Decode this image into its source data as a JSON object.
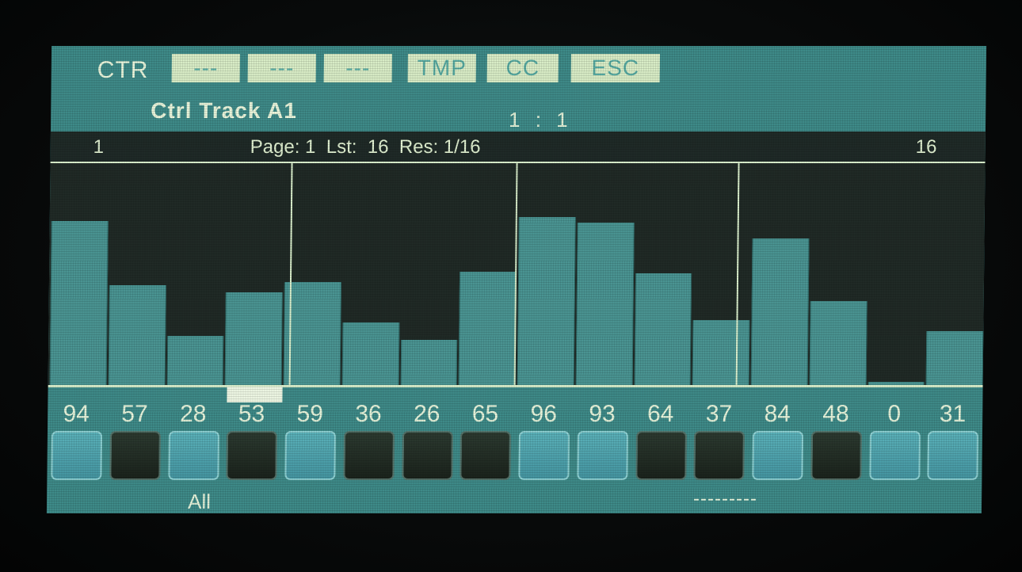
{
  "header": {
    "mode_label": "CTR",
    "softkeys": [
      "---",
      "---",
      "---",
      "TMP",
      "CC",
      "ESC"
    ],
    "track_name": "Ctrl Track A1",
    "position": "1 : 1"
  },
  "infobar": {
    "left_step": "1",
    "page_info": "Page: 1  Lst:  16  Res: 1/16",
    "right_step": "16"
  },
  "steps": [
    {
      "value": "94",
      "active": true
    },
    {
      "value": "57",
      "active": false
    },
    {
      "value": "28",
      "active": true
    },
    {
      "value": "53",
      "active": false
    },
    {
      "value": "59",
      "active": true
    },
    {
      "value": "36",
      "active": false
    },
    {
      "value": "26",
      "active": false
    },
    {
      "value": "65",
      "active": false
    },
    {
      "value": "96",
      "active": true
    },
    {
      "value": "93",
      "active": true
    },
    {
      "value": "64",
      "active": false
    },
    {
      "value": "37",
      "active": false
    },
    {
      "value": "84",
      "active": true
    },
    {
      "value": "48",
      "active": false
    },
    {
      "value": "0",
      "active": true
    },
    {
      "value": "31",
      "active": true
    }
  ],
  "value_max": 127,
  "selected_step": 4,
  "footer": {
    "left_label": "All",
    "right_label": "---------"
  },
  "colors": {
    "screen": "#3e8a88",
    "bar": "#4a9492",
    "graph_bg": "#202a26",
    "text": "#eaf6dc",
    "softkey_bg": "#d8ecc6"
  }
}
